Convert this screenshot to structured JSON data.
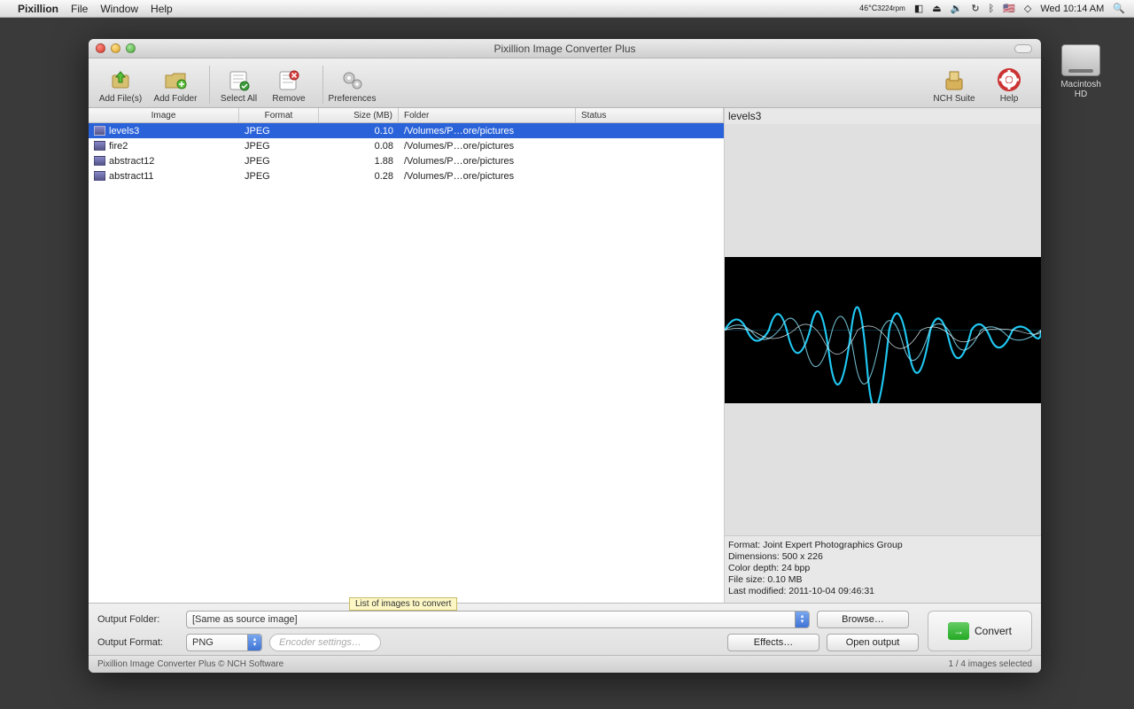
{
  "menubar": {
    "app": "Pixillion",
    "items": [
      "File",
      "Window",
      "Help"
    ],
    "temp1": "46°C",
    "temp2": "3224rpm",
    "clock": "Wed 10:14 AM"
  },
  "desktop": {
    "hd_label": "Macintosh HD"
  },
  "window": {
    "title": "Pixillion Image Converter Plus",
    "toolbar": {
      "add_file": "Add File(s)",
      "add_folder": "Add Folder",
      "select_all": "Select All",
      "remove": "Remove",
      "preferences": "Preferences",
      "nch_suite": "NCH Suite",
      "help": "Help"
    },
    "columns": {
      "image": "Image",
      "format": "Format",
      "size": "Size (MB)",
      "folder": "Folder",
      "status": "Status"
    },
    "rows": [
      {
        "name": "levels3",
        "format": "JPEG",
        "size": "0.10",
        "folder": "/Volumes/P…ore/pictures",
        "status": "",
        "selected": true
      },
      {
        "name": "fire2",
        "format": "JPEG",
        "size": "0.08",
        "folder": "/Volumes/P…ore/pictures",
        "status": "",
        "selected": false
      },
      {
        "name": "abstract12",
        "format": "JPEG",
        "size": "1.88",
        "folder": "/Volumes/P…ore/pictures",
        "status": "",
        "selected": false
      },
      {
        "name": "abstract11",
        "format": "JPEG",
        "size": "0.28",
        "folder": "/Volumes/P…ore/pictures",
        "status": "",
        "selected": false
      }
    ],
    "tooltip": "List of images to convert",
    "preview": {
      "title": "levels3",
      "meta": {
        "format_label": "Format:",
        "format_value": "Joint Expert Photographics Group",
        "dim_label": "Dimensions:",
        "dim_value": "500 x 226",
        "depth_label": "Color depth:",
        "depth_value": "24 bpp",
        "fsize_label": "File size:",
        "fsize_value": "0.10 MB",
        "mod_label": "Last modified:",
        "mod_value": "2011-10-04 09:46:31"
      }
    },
    "controls": {
      "output_folder_label": "Output Folder:",
      "output_folder_value": "[Same as source image]",
      "output_format_label": "Output Format:",
      "output_format_value": "PNG",
      "encoder_placeholder": "Encoder settings…",
      "browse": "Browse…",
      "effects": "Effects…",
      "open_output": "Open output",
      "convert": "Convert"
    },
    "status": {
      "left": "Pixillion Image Converter Plus  © NCH Software",
      "right": "1 / 4 images selected"
    }
  }
}
